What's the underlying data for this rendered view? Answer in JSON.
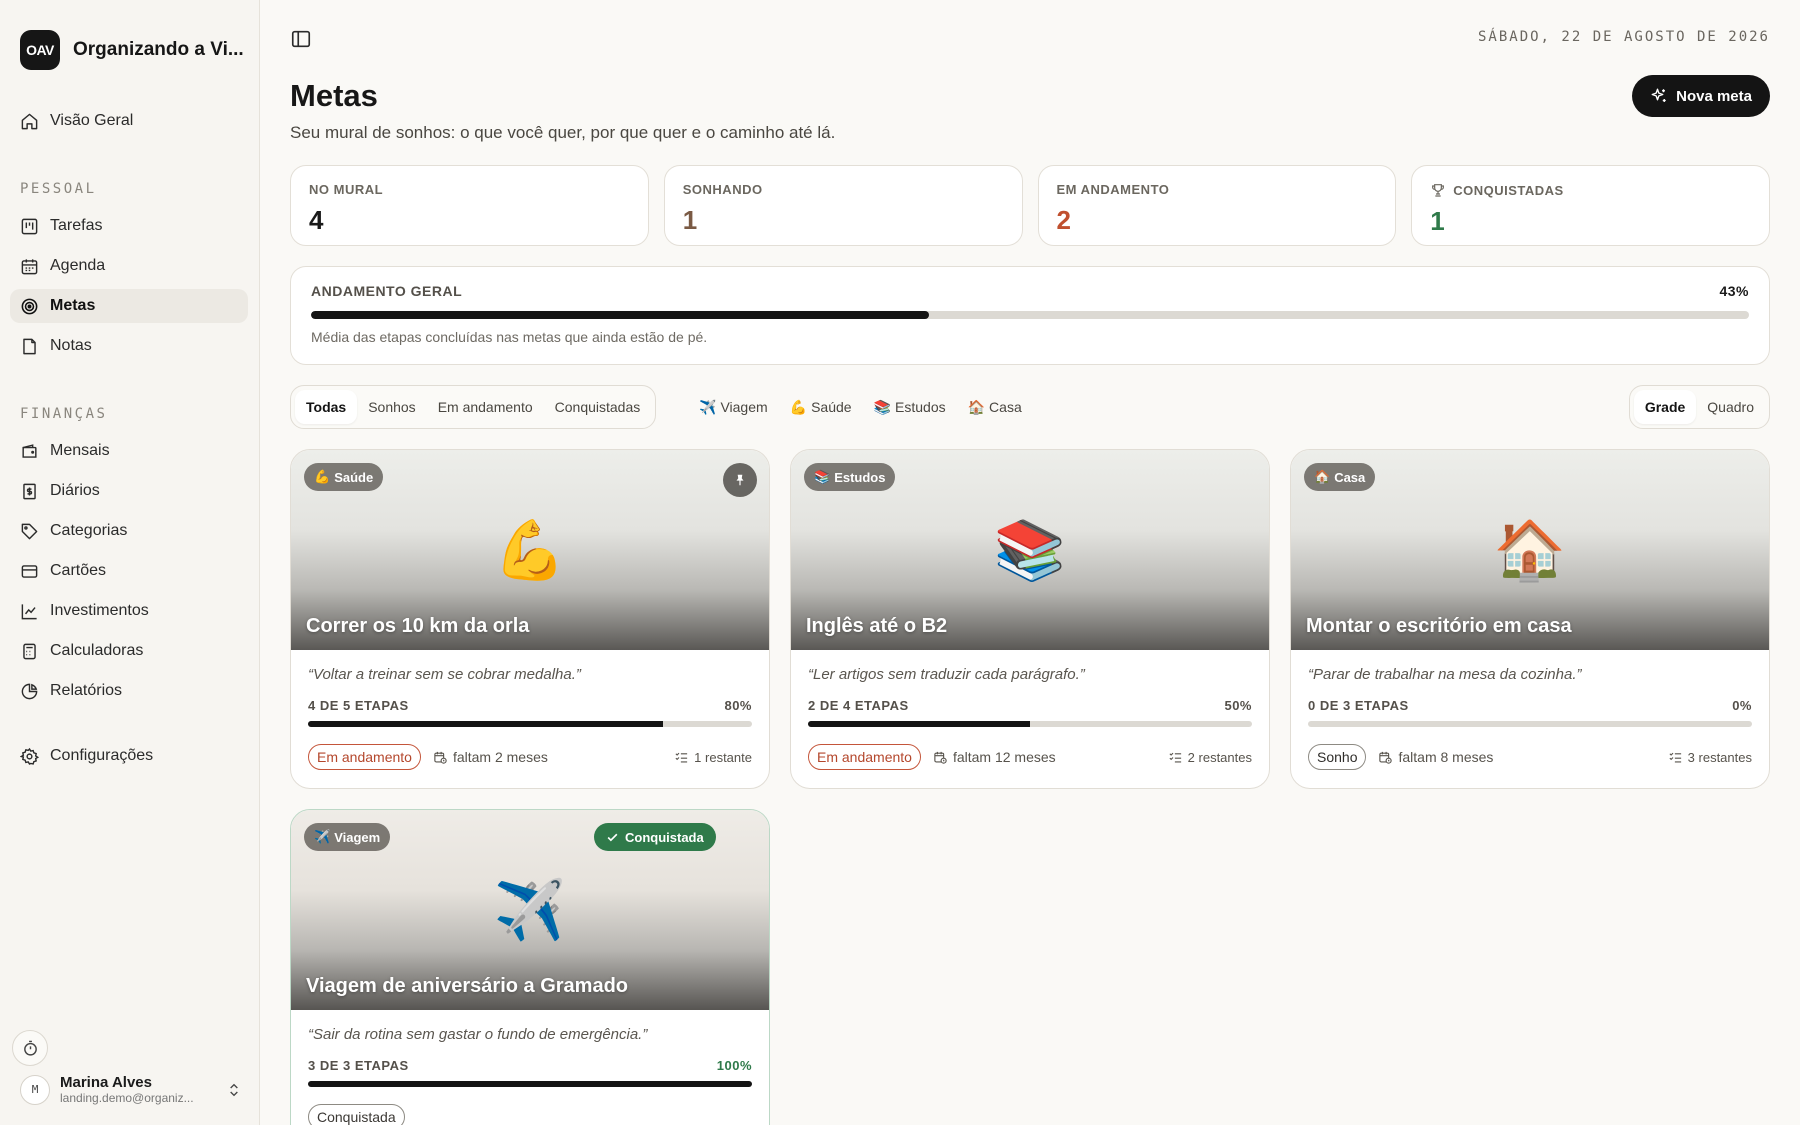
{
  "app": {
    "logo": "OAV",
    "name": "Organizando a Vi..."
  },
  "sidebar": {
    "overview": "Visão Geral",
    "section_personal": "PESSOAL",
    "personal": [
      "Tarefas",
      "Agenda",
      "Metas",
      "Notas"
    ],
    "section_finance": "FINANÇAS",
    "finance": [
      "Mensais",
      "Diários",
      "Categorias",
      "Cartões",
      "Investimentos",
      "Calculadoras",
      "Relatórios"
    ],
    "settings": "Configurações",
    "active": "Metas"
  },
  "user": {
    "initial": "M",
    "name": "Marina Alves",
    "email": "landing.demo@organiz..."
  },
  "header": {
    "date": "SÁBADO, 22 DE AGOSTO DE 2026",
    "title": "Metas",
    "subtitle": "Seu mural de sonhos: o que você quer, por que quer e o caminho até lá.",
    "new_button": "Nova meta"
  },
  "stats": [
    {
      "label": "NO MURAL",
      "value": "4",
      "color": "#1a1a1a"
    },
    {
      "label": "SONHANDO",
      "value": "1",
      "color": "#7a5a44"
    },
    {
      "label": "EM ANDAMENTO",
      "value": "2",
      "color": "#c0502f"
    },
    {
      "label": "CONQUISTADAS",
      "value": "1",
      "color": "#2f7a4a"
    }
  ],
  "overall": {
    "label": "ANDAMENTO GERAL",
    "percent_label": "43%",
    "percent": 43,
    "note": "Média das etapas concluídas nas metas que ainda estão de pé."
  },
  "filters": {
    "status": [
      "Todas",
      "Sonhos",
      "Em andamento",
      "Conquistadas"
    ],
    "status_active": "Todas",
    "categories": [
      {
        "emoji": "✈️",
        "label": "Viagem"
      },
      {
        "emoji": "💪",
        "label": "Saúde"
      },
      {
        "emoji": "📚",
        "label": "Estudos"
      },
      {
        "emoji": "🏠",
        "label": "Casa"
      }
    ],
    "view": [
      "Grade",
      "Quadro"
    ],
    "view_active": "Grade"
  },
  "goals": [
    {
      "category_emoji": "💪",
      "category": "Saúde",
      "emoji": "💪",
      "title": "Correr os 10 km da orla",
      "quote": "“Voltar a treinar sem se cobrar medalha.”",
      "steps": "4 DE 5 ETAPAS",
      "percent_label": "80%",
      "percent": 80,
      "status": "Em andamento",
      "status_kind": "progress",
      "due": "faltam 2 meses",
      "remaining": "1 restante",
      "pinned": true
    },
    {
      "category_emoji": "📚",
      "category": "Estudos",
      "emoji": "📚",
      "title": "Inglês até o B2",
      "quote": "“Ler artigos sem traduzir cada parágrafo.”",
      "steps": "2 DE 4 ETAPAS",
      "percent_label": "50%",
      "percent": 50,
      "status": "Em andamento",
      "status_kind": "progress",
      "due": "faltam 12 meses",
      "remaining": "2 restantes"
    },
    {
      "category_emoji": "🏠",
      "category": "Casa",
      "emoji": "🏠",
      "title": "Montar o escritório em casa",
      "quote": "“Parar de trabalhar na mesa da cozinha.”",
      "steps": "0 DE 3 ETAPAS",
      "percent_label": "0%",
      "percent": 0,
      "status": "Sonho",
      "status_kind": "dream",
      "due": "faltam 8 meses",
      "remaining": "3 restantes"
    },
    {
      "category_emoji": "✈️",
      "category": "Viagem",
      "emoji": "✈️",
      "title": "Viagem de aniversário a Gramado",
      "quote": "“Sair da rotina sem gastar o fundo de emergência.”",
      "steps": "3 DE 3 ETAPAS",
      "percent_label": "100%",
      "percent": 100,
      "status": "Conquistada",
      "status_kind": "achieved",
      "achieved_badge": "Conquistada"
    }
  ]
}
